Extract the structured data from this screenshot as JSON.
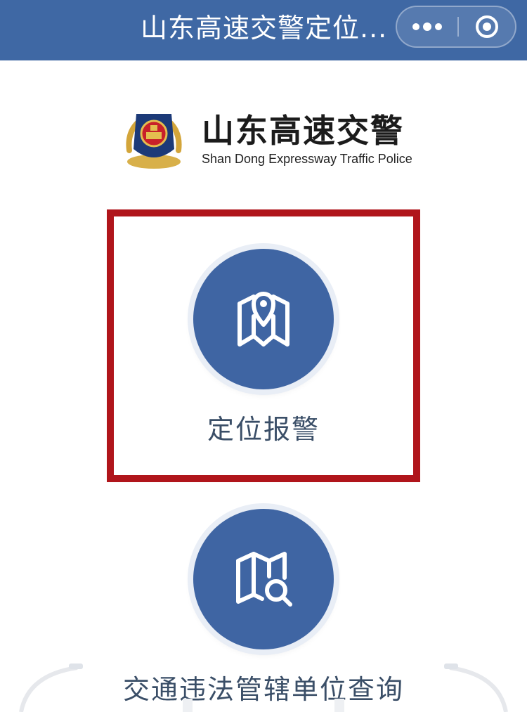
{
  "titlebar": {
    "title": "山东高速交警定位...",
    "more_icon": "more-dots-icon",
    "close_icon": "target-close-icon"
  },
  "brand": {
    "name_cn": "山东高速交警",
    "name_en": "Shan Dong Expressway Traffic Police",
    "emblem_icon": "police-emblem-icon"
  },
  "actions": [
    {
      "label": "定位报警",
      "icon": "map-pin-icon",
      "highlighted": true
    },
    {
      "label": "交通违法管辖单位查询",
      "icon": "map-search-icon",
      "highlighted": false
    }
  ],
  "colors": {
    "titlebar": "#3f68a4",
    "button": "#3f65a3",
    "highlight_border": "#b0151b",
    "label": "#3a4e67"
  }
}
